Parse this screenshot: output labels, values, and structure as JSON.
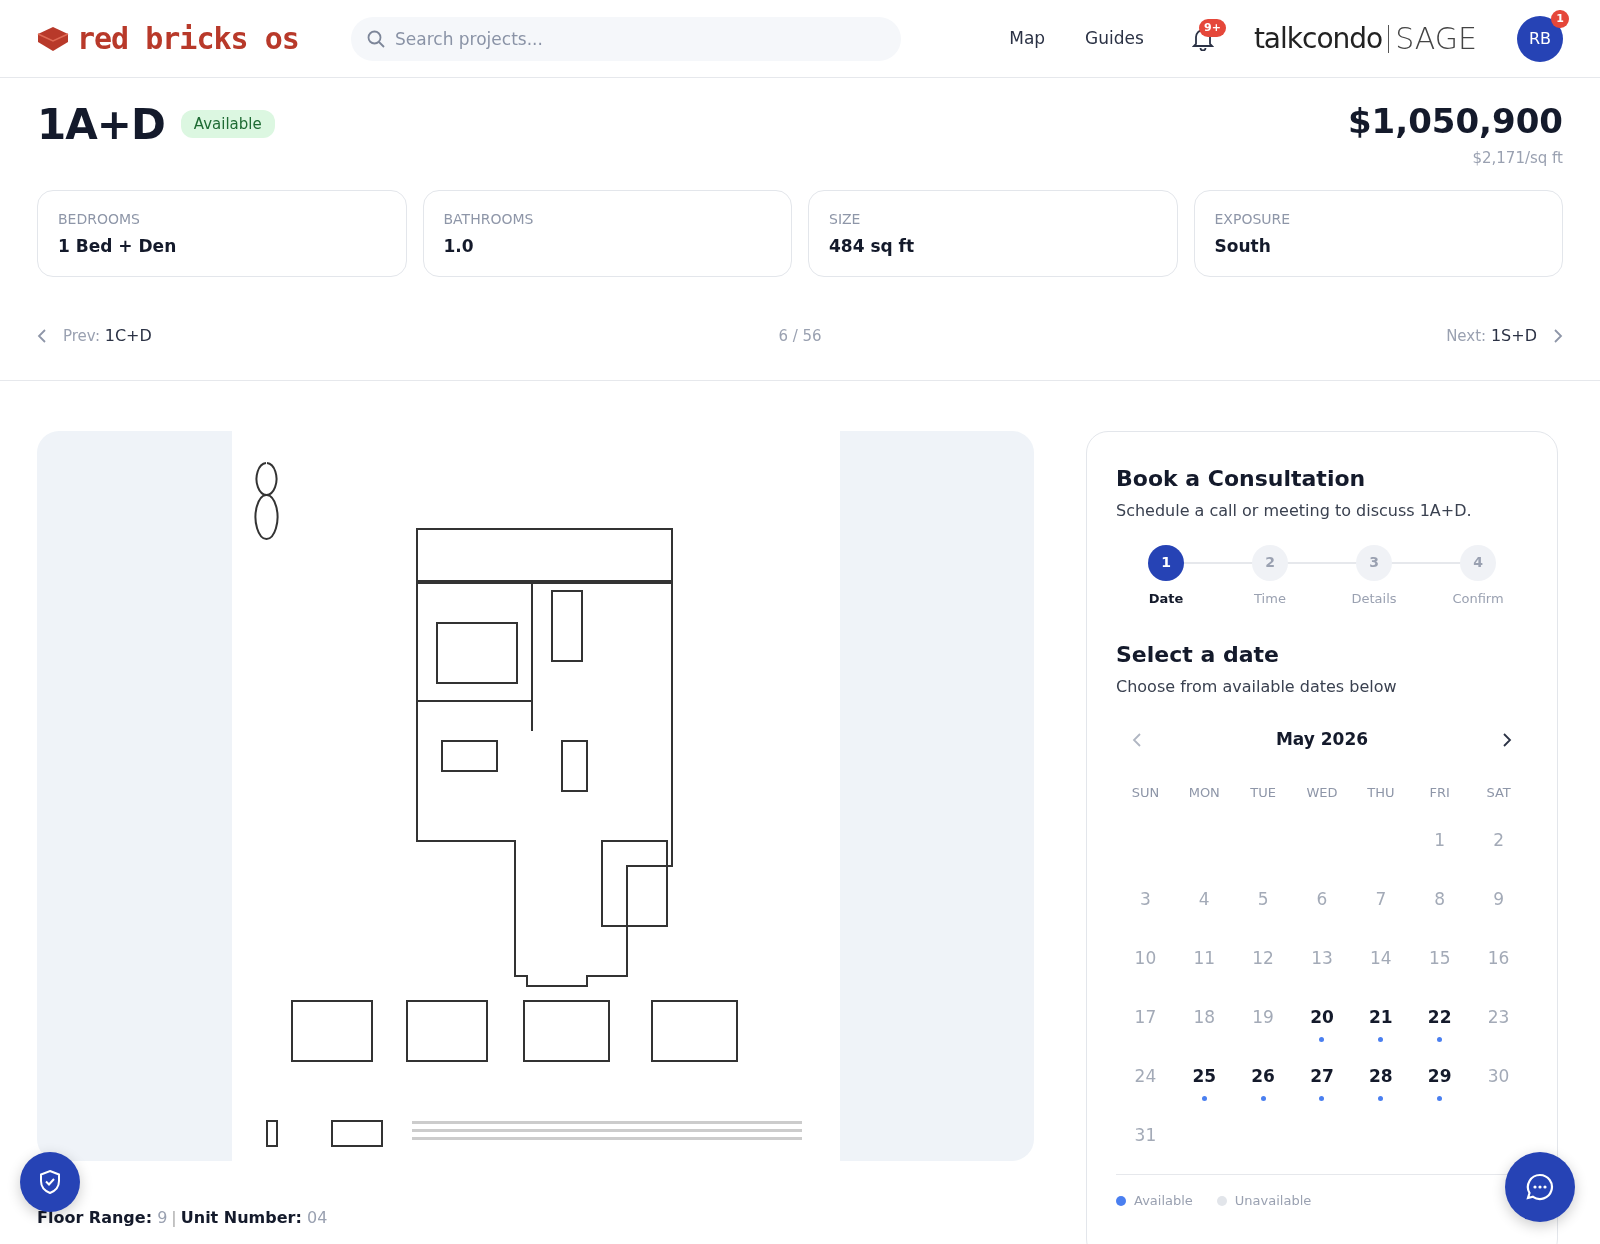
{
  "header": {
    "logo_text": "red bricks os",
    "search": {
      "placeholder": "Search projects..."
    },
    "nav": [
      "Map",
      "Guides"
    ],
    "notifications_badge": "9+",
    "partner_logo": [
      "talkcondo",
      "SAGE"
    ],
    "avatar": {
      "initials": "RB",
      "badge": "1"
    }
  },
  "unit": {
    "name": "1A+D",
    "status": "Available",
    "price": "$1,050,900",
    "price_per_sqft": "$2,171/sq ft"
  },
  "specs": [
    {
      "label": "BEDROOMS",
      "value": "1 Bed + Den"
    },
    {
      "label": "BATHROOMS",
      "value": "1.0"
    },
    {
      "label": "SIZE",
      "value": "484 sq ft"
    },
    {
      "label": "EXPOSURE",
      "value": "South"
    }
  ],
  "pager": {
    "prev_label": "Prev:",
    "prev_unit": "1C+D",
    "position": "6 / 56",
    "next_label": "Next:",
    "next_unit": "1S+D"
  },
  "booking": {
    "title": "Book a Consultation",
    "subtitle": "Schedule a call or meeting to discuss 1A+D.",
    "steps": [
      {
        "number": "1",
        "label": "Date",
        "selected": true
      },
      {
        "number": "2",
        "label": "Time",
        "selected": false
      },
      {
        "number": "3",
        "label": "Details",
        "selected": false
      },
      {
        "number": "4",
        "label": "Confirm",
        "selected": false
      }
    ],
    "section_title": "Select a date",
    "section_subtitle": "Choose from available dates below",
    "month": "May 2026",
    "weekdays": [
      "SUN",
      "MON",
      "TUE",
      "WED",
      "THU",
      "FRI",
      "SAT"
    ],
    "weeks": [
      [
        {
          "kind": "blank"
        },
        {
          "kind": "blank"
        },
        {
          "kind": "blank"
        },
        {
          "kind": "blank"
        },
        {
          "kind": "blank"
        },
        {
          "day": "1",
          "available": false
        },
        {
          "day": "2",
          "available": false
        }
      ],
      [
        {
          "day": "3",
          "available": false
        },
        {
          "day": "4",
          "available": false
        },
        {
          "day": "5",
          "available": false
        },
        {
          "day": "6",
          "available": false
        },
        {
          "day": "7",
          "available": false
        },
        {
          "day": "8",
          "available": false
        },
        {
          "day": "9",
          "available": false
        }
      ],
      [
        {
          "day": "10",
          "available": false
        },
        {
          "day": "11",
          "available": false
        },
        {
          "day": "12",
          "available": false
        },
        {
          "day": "13",
          "available": false
        },
        {
          "day": "14",
          "available": false
        },
        {
          "day": "15",
          "available": false
        },
        {
          "day": "16",
          "available": false
        }
      ],
      [
        {
          "day": "17",
          "available": false
        },
        {
          "day": "18",
          "available": false
        },
        {
          "day": "19",
          "available": false
        },
        {
          "day": "20",
          "available": true
        },
        {
          "day": "21",
          "available": true
        },
        {
          "day": "22",
          "available": true
        },
        {
          "day": "23",
          "available": false
        }
      ],
      [
        {
          "day": "24",
          "available": false
        },
        {
          "day": "25",
          "available": true
        },
        {
          "day": "26",
          "available": true
        },
        {
          "day": "27",
          "available": true
        },
        {
          "day": "28",
          "available": true
        },
        {
          "day": "29",
          "available": true
        },
        {
          "day": "30",
          "available": false
        }
      ],
      [
        {
          "day": "31",
          "available": false
        }
      ]
    ],
    "legend": [
      {
        "label": "Available",
        "color": "#4a7ff0"
      },
      {
        "label": "Unavailable",
        "color": "#e2e5ea"
      }
    ]
  },
  "floor_info": {
    "separator": "|",
    "items": [
      {
        "label": "Floor Range:",
        "value": "9"
      },
      {
        "label": "Unit Number:",
        "value": "04"
      }
    ]
  }
}
